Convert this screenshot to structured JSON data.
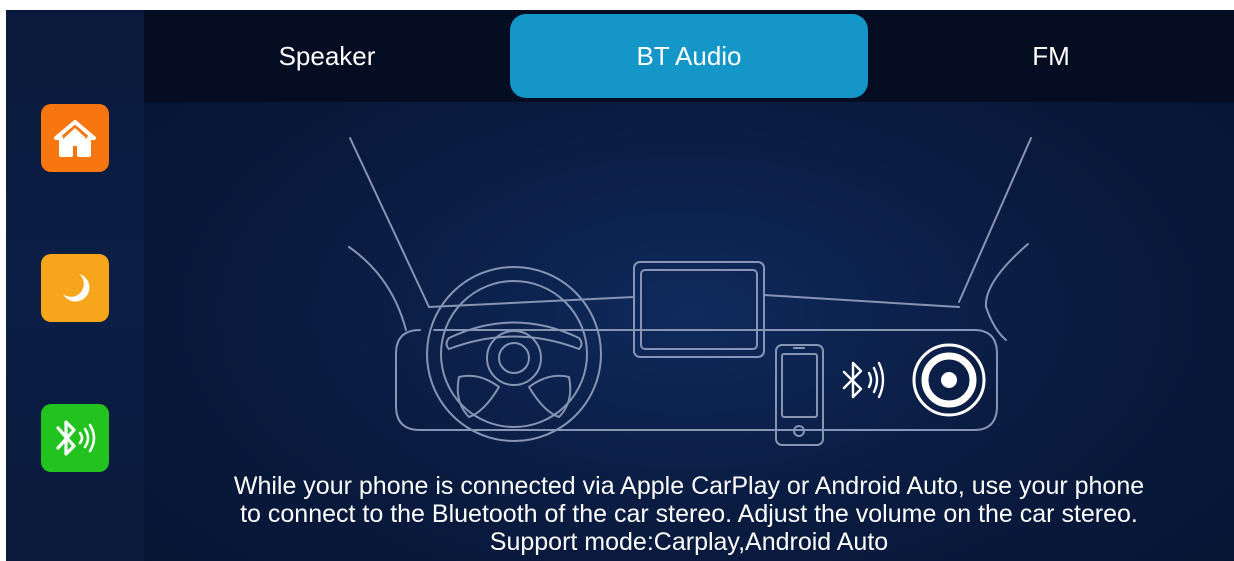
{
  "tabs": [
    {
      "label": "Speaker",
      "active": false
    },
    {
      "label": "BT Audio",
      "active": true
    },
    {
      "label": "FM",
      "active": false
    }
  ],
  "sidebar": {
    "items": [
      {
        "icon": "home-icon",
        "color": "#f7760f"
      },
      {
        "icon": "moon-icon",
        "color": "#f7a51a"
      },
      {
        "icon": "bluetooth-icon",
        "color": "#22c31f"
      }
    ]
  },
  "description": {
    "line1": "While your phone is connected via Apple CarPlay or Android Auto, use your phone",
    "line2": "to connect to the Bluetooth of the car stereo. Adjust the volume on the car stereo.",
    "line3": "Support mode:Carplay,Android Auto"
  },
  "colors": {
    "active_tab": "#1496c8",
    "background": "#07132e"
  }
}
